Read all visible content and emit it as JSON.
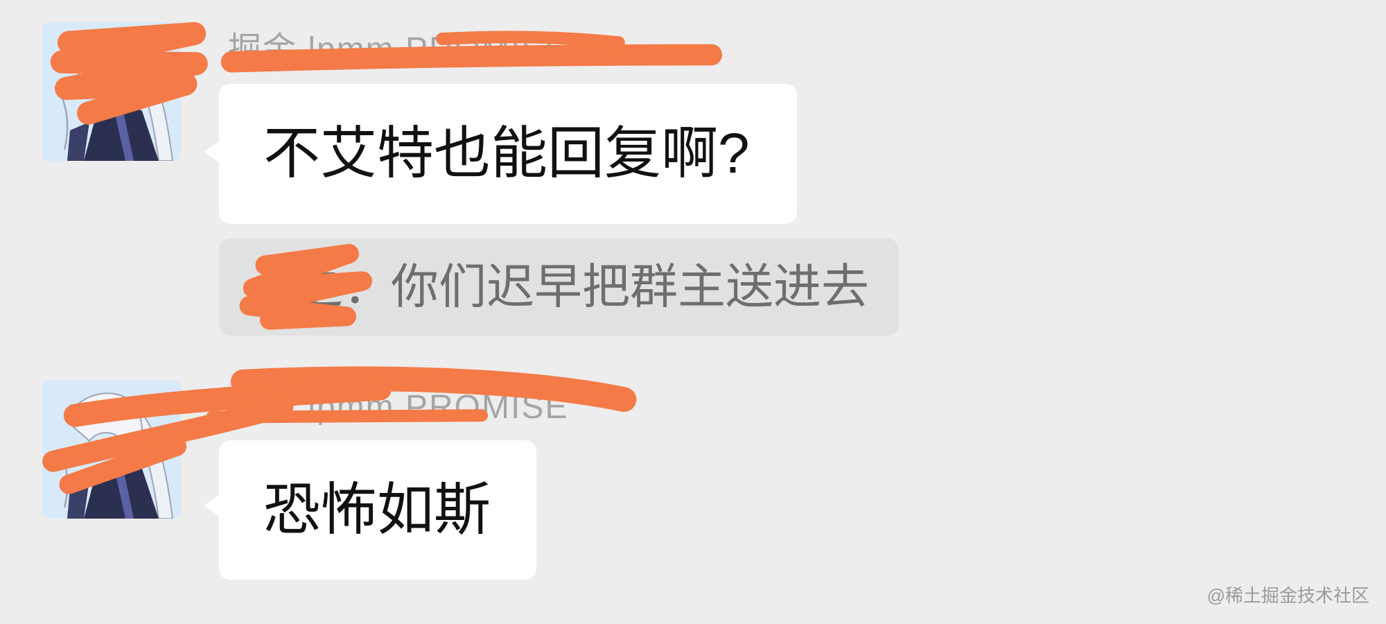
{
  "colors": {
    "background": "#ededed",
    "bubble": "#ffffff",
    "quote_background": "#e1e1e1",
    "redaction": "#f47a47",
    "sender_name": "#a5a5a5",
    "message_text": "#111111",
    "quote_text": "#6e6e6e"
  },
  "messages": [
    {
      "sender_name": "掘金 lpmm PROMISE",
      "text": "不艾特也能回复啊?",
      "quote": {
        "author": "上之",
        "separator": "：",
        "text": "你们迟早把群主送进去"
      }
    },
    {
      "sender_name": "掘金 lpmm PROMISE",
      "text": "恐怖如斯"
    }
  ],
  "watermark": "@稀土掘金技术社区"
}
